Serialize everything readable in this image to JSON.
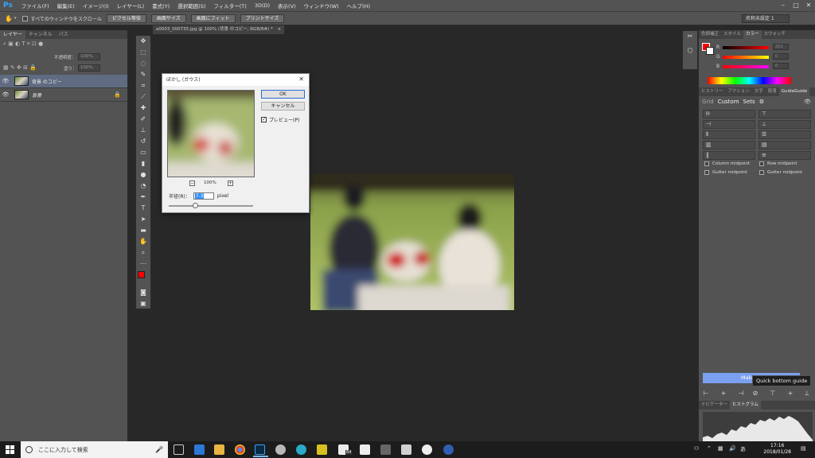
{
  "menubar": {
    "logo": "Ps",
    "items": [
      "ファイル(F)",
      "編集(E)",
      "イメージ(I)",
      "レイヤー(L)",
      "書式(Y)",
      "選択範囲(S)",
      "フィルター(T)",
      "3D(D)",
      "表示(V)",
      "ウィンドウ(W)",
      "ヘルプ(H)"
    ]
  },
  "options": {
    "scroll_all": "すべてのウィンドウをスクロール",
    "buttons": [
      "ピクセル等倍",
      "画面サイズ",
      "画面にフィット",
      "プリントサイズ"
    ],
    "workspace": "名称未設定 1"
  },
  "layers_panel": {
    "tabs": [
      "レイヤー",
      "チャンネル",
      "パス"
    ],
    "opacity_label": "不透明度：",
    "opacity_value": "100%",
    "fill_label": "塗り：",
    "fill_value": "100%",
    "layers": [
      {
        "name": "背景 のコピー",
        "selected": true
      },
      {
        "name": "背景",
        "selected": false
      }
    ]
  },
  "document": {
    "tab_title": "a0003_000735.jpg @ 100% (背景 のコピー, RGB/8#) *"
  },
  "dialog": {
    "title": "ぼかし (ガウス)",
    "ok": "OK",
    "cancel": "キャンセル",
    "preview_label": "プレビュー(P)",
    "zoom": "100%",
    "radius_label": "半径(R)：",
    "radius_value": "7.3",
    "unit": "pixel",
    "radius_fraction": 0.3
  },
  "color_panel": {
    "tabs": [
      "色調補正",
      "スタイル",
      "カラー",
      "スウォッチ"
    ],
    "r_label": "R",
    "g_label": "G",
    "b_label": "B",
    "r_value": "253",
    "g_value": "0",
    "b_value": "0",
    "foreground": "#ff0000"
  },
  "guide_panel": {
    "tabs": [
      "ヒストリー",
      "アクション",
      "文字",
      "段落",
      "GuideGuide"
    ],
    "subtabs": [
      "Grid",
      "Custom",
      "Sets"
    ],
    "checks": [
      "Column midpoint",
      "Row midpoint",
      "Gutter midpoint",
      "Gutter midpoint"
    ],
    "make_button": "Make",
    "tooltip": "Quick bottom guide"
  },
  "nav_panel": {
    "tabs": [
      "ナビゲーター",
      "ヒストグラム"
    ]
  },
  "taskbar": {
    "search_placeholder": "ここに入力して検索",
    "time": "17:16",
    "date": "2018/01/28",
    "ime": "あ",
    "badge": "64"
  }
}
